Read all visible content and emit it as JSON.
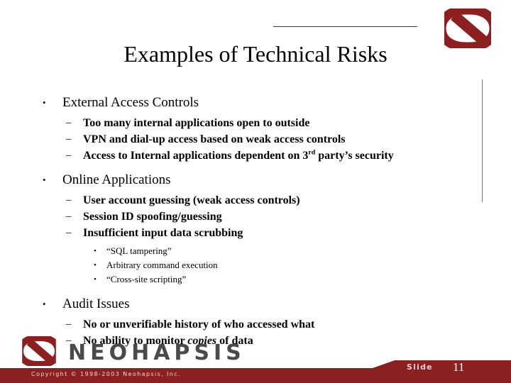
{
  "slide": {
    "title": "Examples of Technical Risks",
    "brand_color": "#8c1f1f",
    "rule_color": "#4a3333",
    "logo_icon": "neohapsis-n-logo-icon",
    "content": [
      {
        "level": 1,
        "text": "External Access Controls",
        "bullet": "•"
      },
      {
        "level": 2,
        "text": "Too many internal applications open to outside",
        "bullet": "–"
      },
      {
        "level": 2,
        "text": "VPN and dial-up access based on weak access controls",
        "bullet": "–"
      },
      {
        "level": 2,
        "text_pre": "Access to Internal applications dependent on 3",
        "text_sup": "rd",
        "text_post": " party’s security",
        "bullet": "–"
      },
      {
        "level": 1,
        "text": "Online Applications",
        "bullet": "•"
      },
      {
        "level": 2,
        "text": "User account guessing (weak access controls)",
        "bullet": "–"
      },
      {
        "level": 2,
        "text": "Session ID spoofing/guessing",
        "bullet": "–"
      },
      {
        "level": 2,
        "text": "Insufficient input data scrubbing",
        "bullet": "–"
      },
      {
        "level": 3,
        "text": "“SQL tampering”",
        "bullet": "•"
      },
      {
        "level": 3,
        "text": "Arbitrary command execution",
        "bullet": "•"
      },
      {
        "level": 3,
        "text": "“Cross-site scripting”",
        "bullet": "•"
      },
      {
        "level": 1,
        "text": "Audit Issues",
        "bullet": "•"
      },
      {
        "level": 2,
        "text": "No or unverifiable history of who accessed what",
        "bullet": "–"
      },
      {
        "level": 2,
        "text_pre": "No ability to monitor ",
        "text_italic": "copies",
        "text_post": " of data",
        "bullet": "–"
      }
    ]
  },
  "footer": {
    "wordmark": "NEOHAPSIS",
    "logo_icon": "neohapsis-n-logo-icon",
    "copyright": "Copyright © 1998-2003 Neohapsis, Inc.",
    "slide_label": "Slide",
    "slide_number": "11",
    "band_color": "#8c2020",
    "wordmark_color": "#4a4a4a"
  }
}
